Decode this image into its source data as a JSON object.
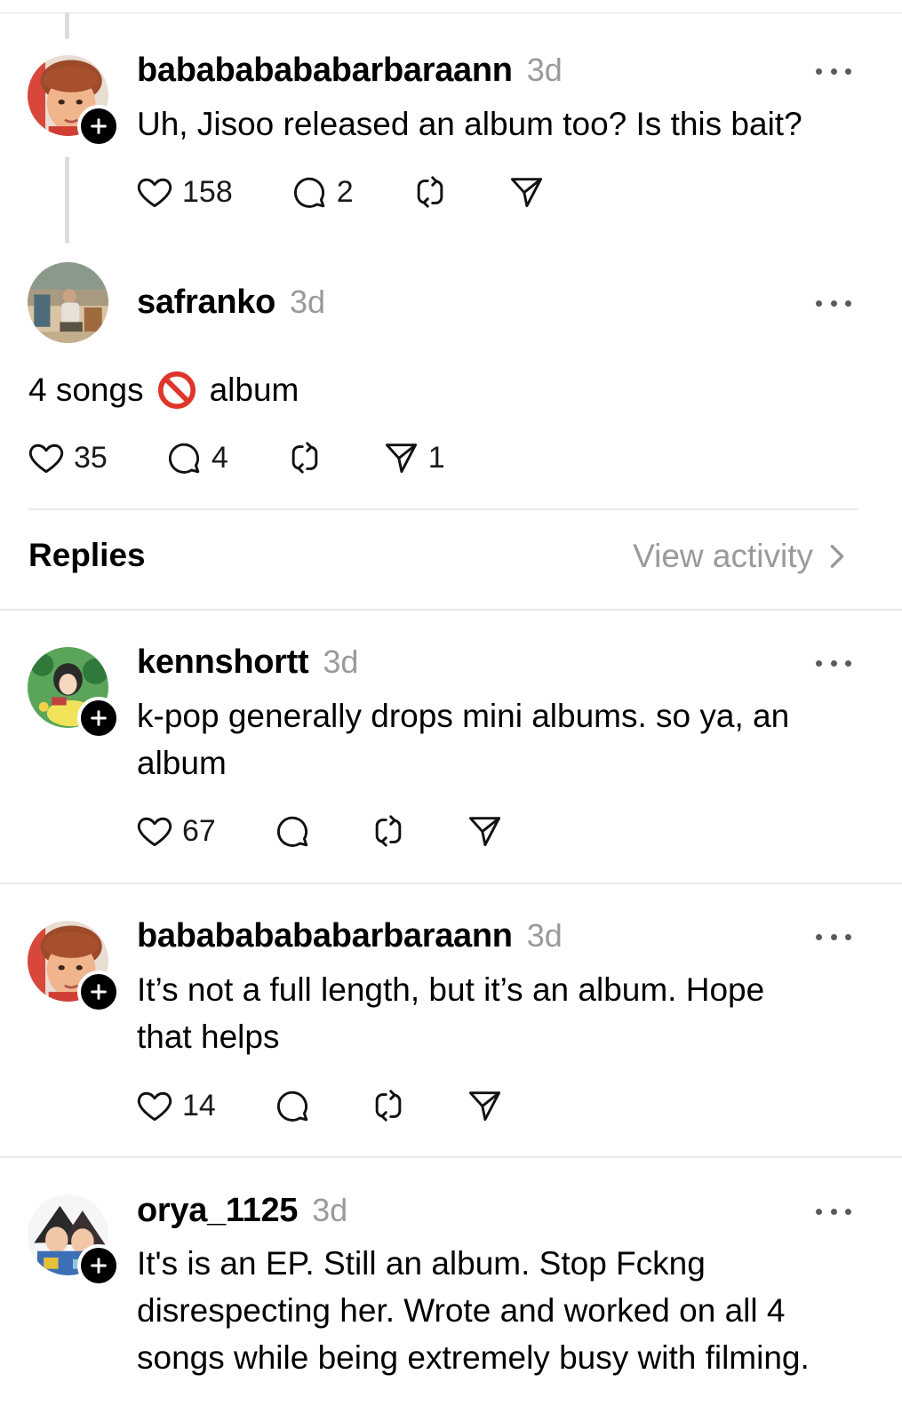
{
  "posts": [
    {
      "username": "babababababarbaraann",
      "time": "3d",
      "text": "Uh, Jisoo released an album too? Is this bait?",
      "likes": "158",
      "comments": "2",
      "reposts": "",
      "shares": "",
      "avatar_icon": "avatar-boy-icon",
      "has_follow_badge": true
    },
    {
      "username": "safranko",
      "time": "3d",
      "text_before": "4 songs",
      "text_after": "album",
      "inline_icon": "prohibited-emoji-icon",
      "likes": "35",
      "comments": "4",
      "reposts": "",
      "shares": "1",
      "avatar_icon": "avatar-beach-icon",
      "has_follow_badge": false
    }
  ],
  "replies_header": {
    "title": "Replies",
    "view_activity": "View activity"
  },
  "replies": [
    {
      "username": "kennshortt",
      "time": "3d",
      "text_line1": "k-pop generally drops mini albums. so ya, an",
      "text_line2": "album",
      "likes": "67",
      "comments": "",
      "reposts": "",
      "shares": "",
      "avatar_icon": "avatar-anime-girl-icon"
    },
    {
      "username": "babababababarbaraann",
      "time": "3d",
      "text_line1": "It’s not a full length, but it’s an album. Hope",
      "text_line2": "that helps",
      "likes": "14",
      "comments": "",
      "reposts": "",
      "shares": "",
      "avatar_icon": "avatar-boy-icon"
    },
    {
      "username": "orya_1125",
      "time": "3d",
      "text_line1": "It's is an EP. Still an album. Stop Fckng",
      "text_line2": "disrespecting her. Wrote and worked on all 4",
      "text_line3": "songs while being extremely busy with filming.",
      "avatar_icon": "avatar-anime-pair-icon"
    }
  ],
  "colors": {
    "text": "#000000",
    "muted": "#9a9a9a",
    "divider": "#e8e8e8",
    "thread_line": "#dcdcdc",
    "badge": "#000000"
  }
}
